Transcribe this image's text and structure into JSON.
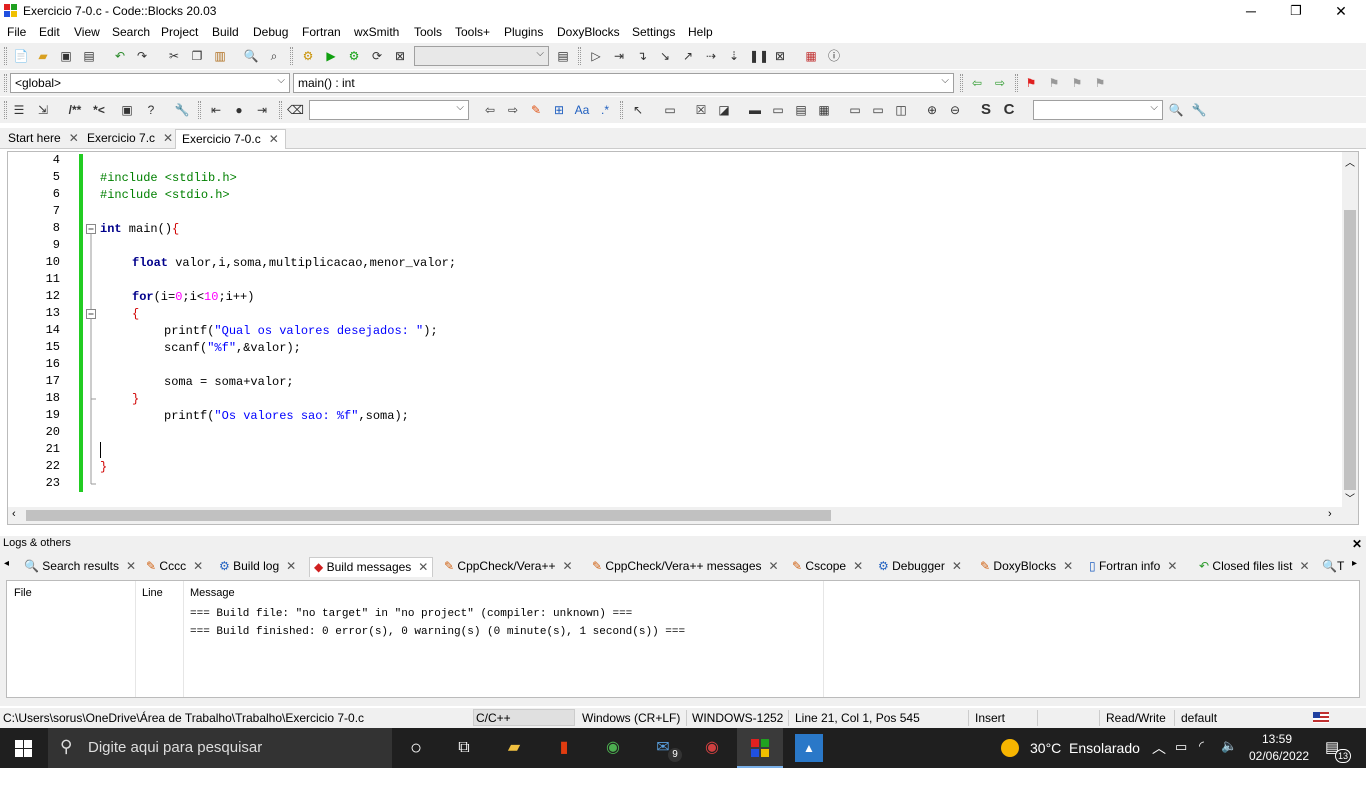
{
  "window": {
    "title": "Exercicio 7-0.c - Code::Blocks 20.03",
    "minimize": "─",
    "maximize": "❐",
    "close": "✕"
  },
  "menu": [
    "File",
    "Edit",
    "View",
    "Search",
    "Project",
    "Build",
    "Debug",
    "Fortran",
    "wxSmith",
    "Tools",
    "Tools+",
    "Plugins",
    "DoxyBlocks",
    "Settings",
    "Help"
  ],
  "toolbar2": {
    "scope": "<global>",
    "function": "main() : int"
  },
  "tabs": [
    {
      "label": "Start here",
      "close": "✕"
    },
    {
      "label": "Exercicio 7.c",
      "close": "✕"
    },
    {
      "label": "Exercicio 7-0.c",
      "close": "✕"
    }
  ],
  "editor": {
    "line_numbers": [
      "4",
      "5",
      "6",
      "7",
      "8",
      "9",
      "10",
      "11",
      "12",
      "13",
      "14",
      "15",
      "16",
      "17",
      "18",
      "19",
      "20",
      "21",
      "22",
      "23"
    ],
    "lines": {
      "l5": "#include <stdlib.h>",
      "l6": "#include <stdio.h>",
      "l8_kw": "int",
      "l8_rest": " main()",
      "l8_brace": "{",
      "l10_kw": "float",
      "l10_rest": " valor,i,soma,multiplicacao,menor_valor;",
      "l12_kw": "for",
      "l12_a": "(i=",
      "l12_n0": "0",
      "l12_b": ";i<",
      "l12_n10": "10",
      "l12_c": ";i++)",
      "l13": "{",
      "l14_a": "printf(",
      "l14_str": "\"Qual os valores desejados: \"",
      "l14_b": ");",
      "l15_a": "scanf(",
      "l15_str": "\"%f\"",
      "l15_b": ",&valor);",
      "l17": "soma = soma+valor;",
      "l18": "}",
      "l19_a": "printf(",
      "l19_str": "\"Os valores sao: %f\"",
      "l19_b": ",soma);",
      "l22": "}"
    }
  },
  "logs": {
    "header": "Logs & others",
    "close": "✕",
    "tabs": [
      {
        "label": "Search results"
      },
      {
        "label": "Cccc"
      },
      {
        "label": "Build log"
      },
      {
        "label": "Build messages"
      },
      {
        "label": "CppCheck/Vera++"
      },
      {
        "label": "CppCheck/Vera++ messages"
      },
      {
        "label": "Cscope"
      },
      {
        "label": "Debugger"
      },
      {
        "label": "DoxyBlocks"
      },
      {
        "label": "Fortran info"
      },
      {
        "label": "Closed files list"
      },
      {
        "label": "T"
      }
    ],
    "columns": [
      "File",
      "Line",
      "Message"
    ],
    "messages": [
      "=== Build file: \"no target\" in \"no project\" (compiler: unknown) ===",
      "=== Build finished: 0 error(s), 0 warning(s) (0 minute(s), 1 second(s)) ==="
    ]
  },
  "status": {
    "path": "C:\\Users\\sorus\\OneDrive\\Área de Trabalho\\Trabalho\\Exercicio 7-0.c",
    "lang": "C/C++",
    "eol": "Windows (CR+LF)",
    "encoding": "WINDOWS-1252",
    "position": "Line 21, Col 1, Pos 545",
    "mode": "Insert",
    "access": "Read/Write",
    "profile": "default"
  },
  "taskbar": {
    "search_placeholder": "Digite aqui para pesquisar",
    "mail_badge": "9",
    "weather": "30°C  Ensolarado",
    "time": "13:59",
    "date": "02/06/2022",
    "notif_badge": "13"
  }
}
